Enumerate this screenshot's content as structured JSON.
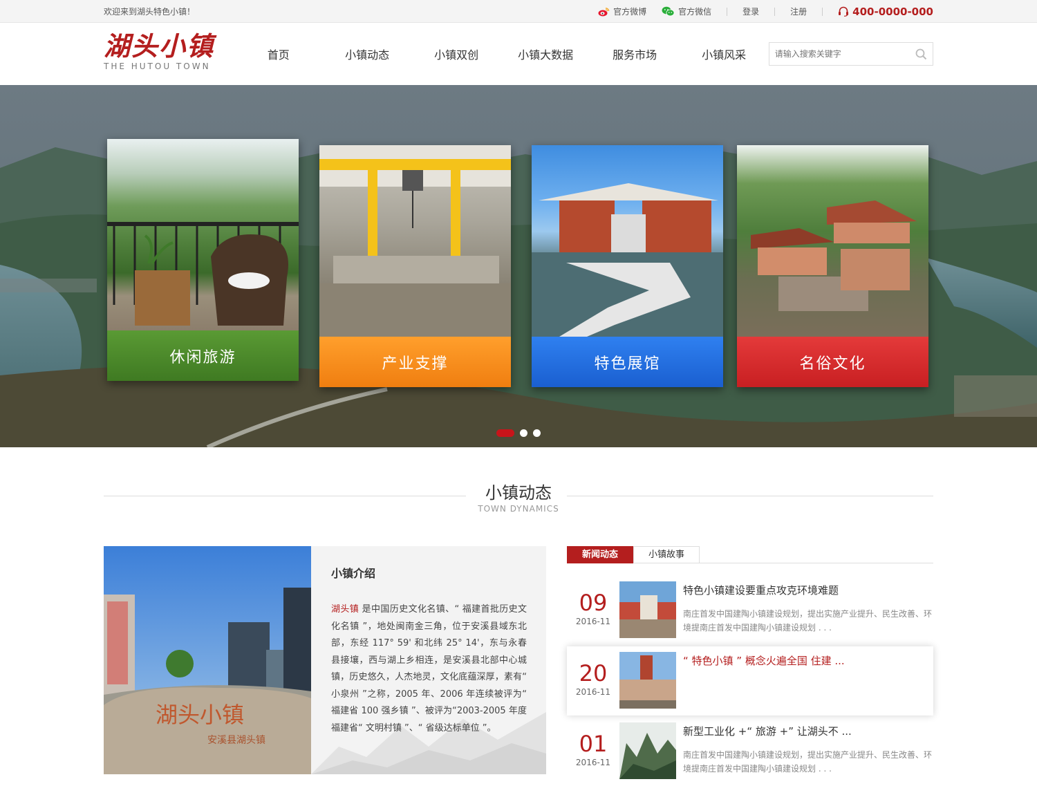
{
  "topbar": {
    "welcome": "欢迎来到湖头特色小镇！",
    "weibo": "官方微博",
    "wechat": "官方微信",
    "login": "登录",
    "register": "注册",
    "phone": "400-0000-000"
  },
  "header": {
    "logo_cn": "湖头小镇",
    "logo_en": "THE HUTOU TOWN",
    "nav": [
      "首页",
      "小镇动态",
      "小镇双创",
      "小镇大数据",
      "服务市场",
      "小镇风采"
    ],
    "search_placeholder": "请输入搜索关键字"
  },
  "banner": {
    "cards": [
      {
        "label": "休闲旅游",
        "color": "#4e8a2c"
      },
      {
        "label": "产业支撑",
        "color": "#f38a1c"
      },
      {
        "label": "特色展馆",
        "color": "#1f6fe0"
      },
      {
        "label": "名俗文化",
        "color": "#d42a2a"
      }
    ]
  },
  "section": {
    "title": "小镇动态",
    "subtitle": "TOWN DYNAMICS"
  },
  "intro": {
    "heading": "小镇介绍",
    "highlight": "湖头镇",
    "body": " 是中国历史文化名镇、“ 福建首批历史文化名镇 ”，地处闽南金三角，位于安溪县域东北部，东经 117° 59' 和北纬 25° 14'，东与永春县接壤，西与湖上乡相连，是安溪县北部中心城镇，历史悠久，人杰地灵，文化底蕴深厚，素有“ 小泉州 ”之称，2005 年、2006 年连续被评为“ 福建省 100 强乡镇 ”、被评为“2003-2005 年度福建省“ 文明村镇 ”、“ 省级达标单位 ”。",
    "stone_text": "湖头小镇",
    "stone_sub": "安溪县湖头镇"
  },
  "news": {
    "tabs": [
      "新闻动态",
      "小镇故事"
    ],
    "items": [
      {
        "day": "09",
        "month": "2016-11",
        "title": "特色小镇建设要重点攻克环境难题",
        "summary": "南庄首发中国建陶小镇建设规划，提出实施产业提升、民生改善、环境提南庄首发中国建陶小镇建设规划 . . ."
      },
      {
        "day": "20",
        "month": "2016-11",
        "title": "“ 特色小镇 ” 概念火遍全国  住建 ...",
        "summary": ""
      },
      {
        "day": "01",
        "month": "2016-11",
        "title": "新型工业化 +“ 旅游 +” 让湖头不 ...",
        "summary": "南庄首发中国建陶小镇建设规划，提出实施产业提升、民生改善、环境提南庄首发中国建陶小镇建设规划 . . ."
      }
    ]
  }
}
